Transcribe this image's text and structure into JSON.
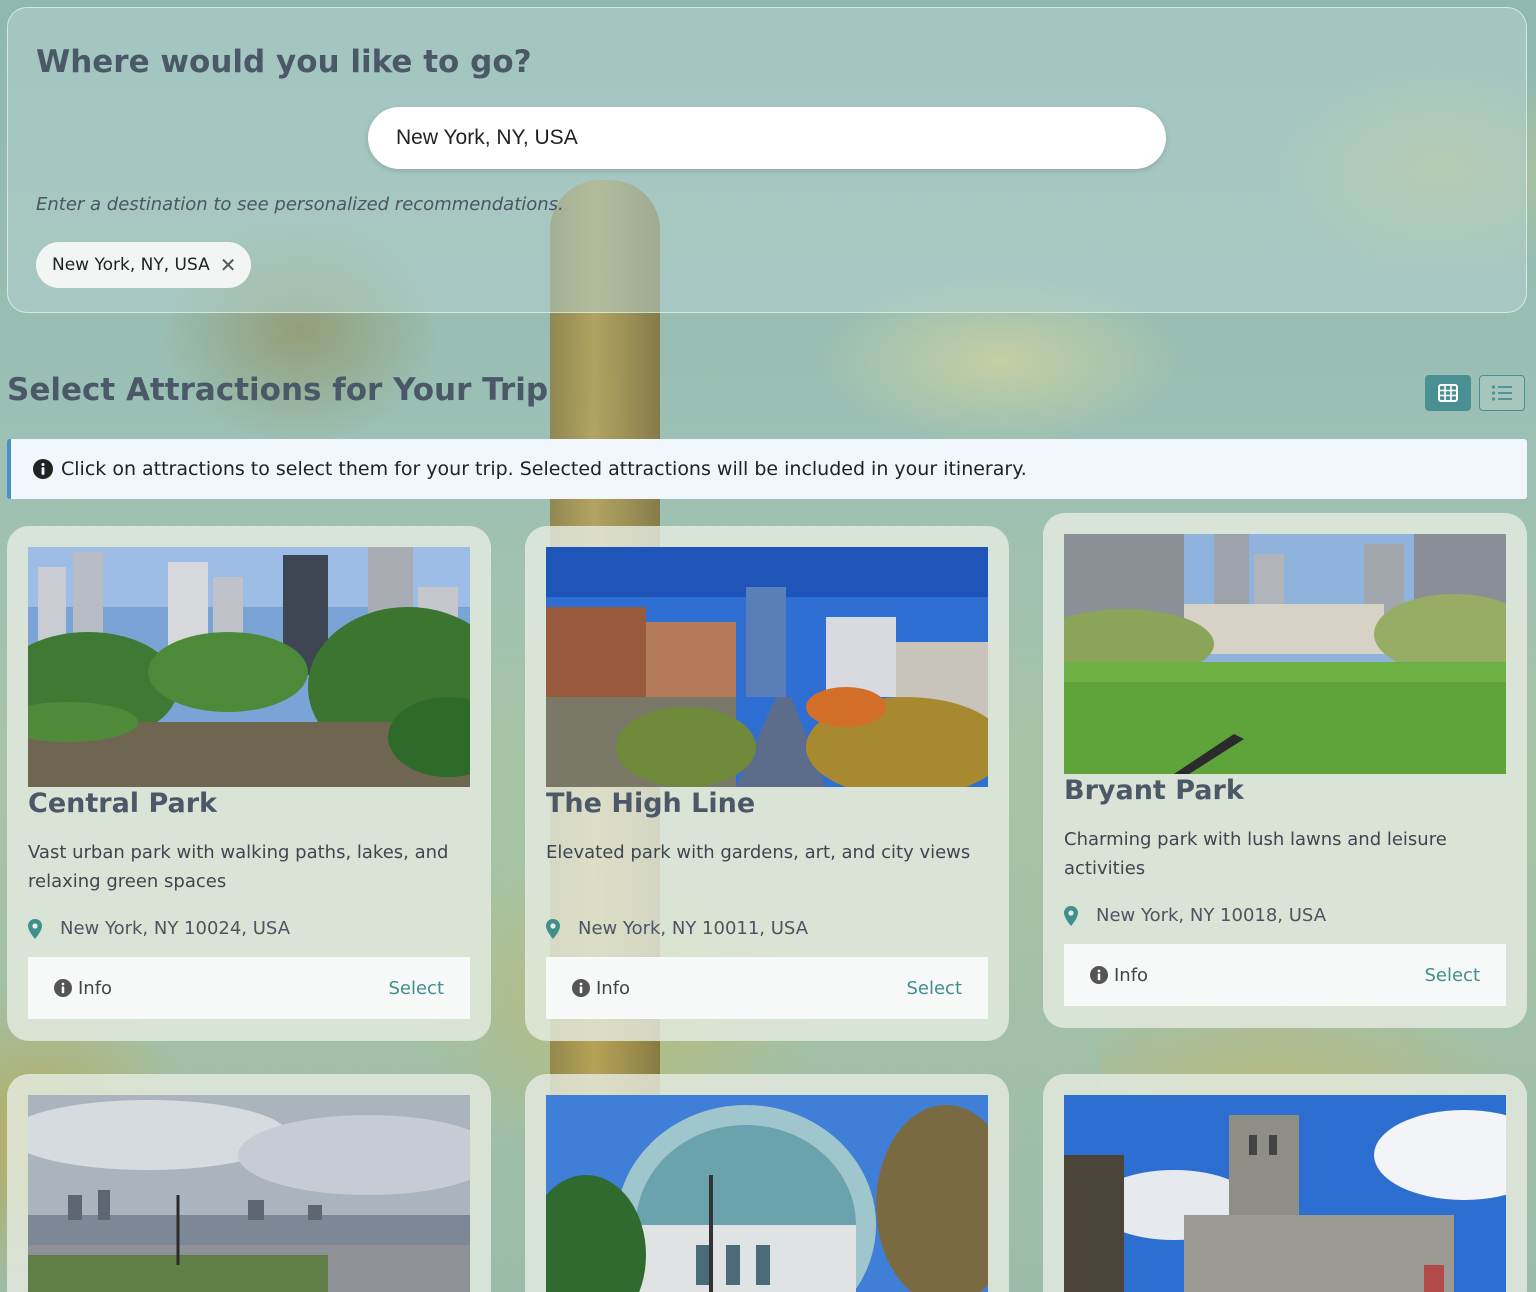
{
  "search": {
    "title": "Where would you like to go?",
    "input_value": "New York, NY, USA",
    "hint": "Enter a destination to see personalized recommendations.",
    "chip_label": "New York, NY, USA",
    "chip_close": "✕"
  },
  "attractions": {
    "title": "Select Attractions for Your Trip",
    "view_modes": [
      "grid",
      "list"
    ],
    "active_view": "grid",
    "info_banner": "Click on attractions to select them for your trip. Selected attractions will be included in your itinerary.",
    "info_label": "Info",
    "select_label": "Select",
    "cards": [
      {
        "name": "Central Park",
        "description": "Vast urban park with walking paths, lakes, and relaxing green spaces",
        "address": "New York, NY 10024, USA"
      },
      {
        "name": "The High Line",
        "description": "Elevated park with gardens, art, and city views",
        "address": "New York, NY 10011, USA"
      },
      {
        "name": "Bryant Park",
        "description": "Charming park with lush lawns and leisure activities",
        "address": "New York, NY 10018, USA"
      }
    ]
  },
  "colors": {
    "accent": "#4a9093",
    "select_text": "#3f8f8c",
    "banner_border": "#4a90c8",
    "heading": "#4a5868"
  },
  "icons": {
    "info": "info-circle-icon",
    "location": "map-pin-icon",
    "grid_view": "grid-icon",
    "list_view": "list-icon"
  }
}
